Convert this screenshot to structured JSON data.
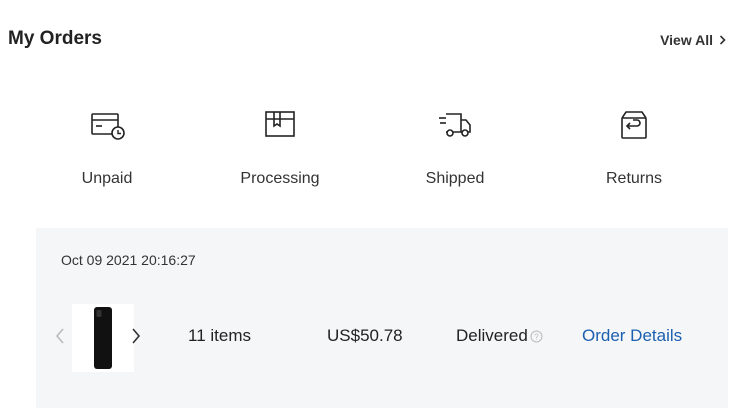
{
  "header": {
    "title": "My Orders",
    "view_all": "View All"
  },
  "status_tabs": [
    {
      "label": "Unpaid",
      "icon": "card-clock-icon"
    },
    {
      "label": "Processing",
      "icon": "box-icon"
    },
    {
      "label": "Shipped",
      "icon": "truck-icon"
    },
    {
      "label": "Returns",
      "icon": "return-box-icon"
    }
  ],
  "order": {
    "date": "Oct 09 2021 20:16:27",
    "items": "11 items",
    "price": "US$50.78",
    "status": "Delivered",
    "details_link": "Order Details"
  },
  "colors": {
    "card_bg": "#f5f6f8",
    "link": "#1b5fb0",
    "text": "#222222"
  }
}
